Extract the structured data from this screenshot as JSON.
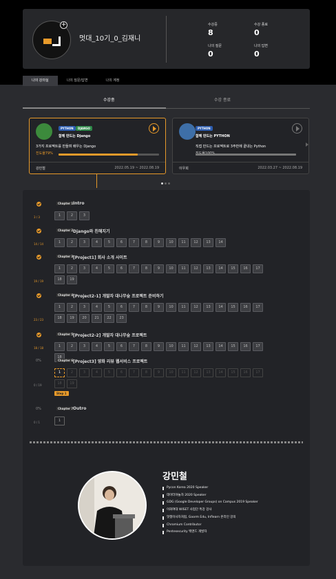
{
  "profile": {
    "username": "멋대_10기_0_김재니",
    "stats": [
      {
        "label": "수강중",
        "value": "8"
      },
      {
        "label": "수강 종료",
        "value": "0"
      },
      {
        "label": "나의 질문",
        "value": "0"
      },
      {
        "label": "나의 답변",
        "value": "0"
      }
    ]
  },
  "tabs": [
    "나의 강의실",
    "나의 질문/답변",
    "나의 계정"
  ],
  "subtabs": [
    "수강중",
    "수강 종료"
  ],
  "cards": [
    {
      "tags": [
        "PYTHON",
        "DJANGO"
      ],
      "title": "함께 만드는 Django",
      "desc": "3가지 프로젝트를 만들며 배우는 Django",
      "progress_text": "진도율79%",
      "progress": 0.79,
      "instructor": "강민철",
      "dates": "2022.05.19 ~ 2022.08.19"
    },
    {
      "tags": [
        "PYTHON"
      ],
      "title": "함께 만드는 PYTHON",
      "desc": "직접 만드는 프로젝트로 3주만에 끝내는 Python",
      "progress_text": "진도율100%",
      "progress": 1.0,
      "instructor": "이우희",
      "dates": "2022.03.27 ~ 2022.08.19"
    }
  ],
  "curriculum": [
    {
      "label": "Chapter 1",
      "title": "Intro",
      "count": "3 / 3",
      "status": "done",
      "lessons": [
        "1",
        "2",
        "3"
      ]
    },
    {
      "label": "Chapter 2",
      "title": "Django와 친해지기",
      "count": "14 / 14",
      "status": "done",
      "lessons": [
        "1",
        "2",
        "3",
        "4",
        "5",
        "6",
        "7",
        "8",
        "9",
        "10",
        "11",
        "12",
        "13",
        "14"
      ]
    },
    {
      "label": "Chapter 3",
      "title": "[Project1] 회사 소개 사이트",
      "count": "19 / 19",
      "status": "done",
      "lessons": [
        "1",
        "2",
        "3",
        "4",
        "5",
        "6",
        "7",
        "8",
        "9",
        "10",
        "11",
        "12",
        "13",
        "14",
        "15",
        "16",
        "17",
        "18",
        "19"
      ]
    },
    {
      "label": "Chapter 4",
      "title": "[Project2-1] 개발자 대나무숲 프로젝트 준비하기",
      "count": "23 / 23",
      "status": "done",
      "lessons": [
        "1",
        "2",
        "3",
        "4",
        "5",
        "6",
        "7",
        "8",
        "9",
        "10",
        "11",
        "12",
        "13",
        "14",
        "15",
        "16",
        "17",
        "18",
        "19",
        "20",
        "21",
        "22",
        "23"
      ]
    },
    {
      "label": "Chapter 5",
      "title": "[Project2-2] 개발자 대나무숲 프로젝트",
      "count": "18 / 18",
      "status": "done",
      "lessons": [
        "1",
        "2",
        "3",
        "4",
        "5",
        "6",
        "7",
        "8",
        "9",
        "10",
        "11",
        "12",
        "13",
        "14",
        "15",
        "16",
        "17",
        "18"
      ]
    },
    {
      "label": "Chapter 6",
      "title": "[Project3] 영화 리뷰 웹서비스 프로젝트",
      "count": "0 / 19",
      "pct": "0%",
      "status": "todo",
      "step": "Step 1",
      "lessons": [
        "1",
        "2",
        "3",
        "4",
        "5",
        "6",
        "7",
        "8",
        "9",
        "10",
        "11",
        "12",
        "13",
        "14",
        "15",
        "16",
        "17",
        "18",
        "19"
      ]
    },
    {
      "label": "Chapter 7",
      "title": "Outro",
      "count": "0 / 1",
      "pct": "0%",
      "status": "outro",
      "lessons": [
        "1"
      ]
    }
  ],
  "instructor": {
    "name": "강민철",
    "bio": [
      "Pycon Korea 2020 Speaker",
      "데이터야놀자 2020 Speaker",
      "GDG (Google Developer Groups) on Campus 2019 Speaker",
      "이화여대 WISET 사업단 특강 강사",
      "멋쟁이사자처럼, Goorm Edu, Inflearn 온라인 강의",
      "Chromium Contributor",
      "Pentesecurity 백엔드 개발자"
    ]
  },
  "colors": {
    "accent": "#e89a2a",
    "bg": "#2a2b2f",
    "panel": "#222327"
  }
}
